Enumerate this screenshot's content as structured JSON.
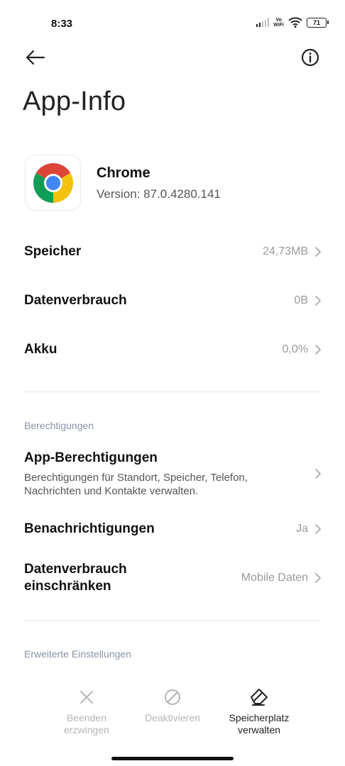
{
  "status_bar": {
    "time": "8:33",
    "vowifi_top": "Vo",
    "vowifi_bottom": "WiFi",
    "battery": "71"
  },
  "header": {
    "title": "App-Info",
    "back_icon": "arrow-left-icon",
    "info_icon": "info-circle-icon"
  },
  "app": {
    "name": "Chrome",
    "version": "Version: 87.0.4280.141",
    "icon": "chrome-logo"
  },
  "rows": [
    {
      "label": "Speicher",
      "value": "24,73MB"
    },
    {
      "label": "Datenverbrauch",
      "value": "0B"
    },
    {
      "label": "Akku",
      "value": "0,0%"
    }
  ],
  "permissions": {
    "section_title": "Berechtigungen",
    "app_permissions": {
      "label": "App-Berechtigungen",
      "description_line1": "Berechtigungen für Standort, Speicher, Telefon,",
      "description_line2": "Nachrichten und Kontakte verwalten."
    },
    "notifications": {
      "label": "Benachrichtigungen",
      "value": "Ja"
    },
    "data_restriction": {
      "label_line1": "Datenverbrauch",
      "label_line2": "einschränken",
      "value": "Mobile Daten"
    }
  },
  "advanced": {
    "section_title": "Erweiterte Einstellungen"
  },
  "bottom_actions": [
    {
      "line1": "Beenden",
      "line2": "erzwingen",
      "icon": "close-x-icon",
      "enabled": false
    },
    {
      "line1": "Deaktivieren",
      "line2": "",
      "icon": "block-icon",
      "enabled": false
    },
    {
      "line1": "Speicherplatz",
      "line2": "verwalten",
      "icon": "eraser-icon",
      "enabled": true
    }
  ],
  "colors": {
    "chrome_red": "#DB4437",
    "chrome_yellow": "#F4C20D",
    "chrome_green": "#0F9D58",
    "chrome_blue": "#4285F4",
    "section_header": "#8a93a6",
    "value_gray": "#9a9a9a"
  }
}
